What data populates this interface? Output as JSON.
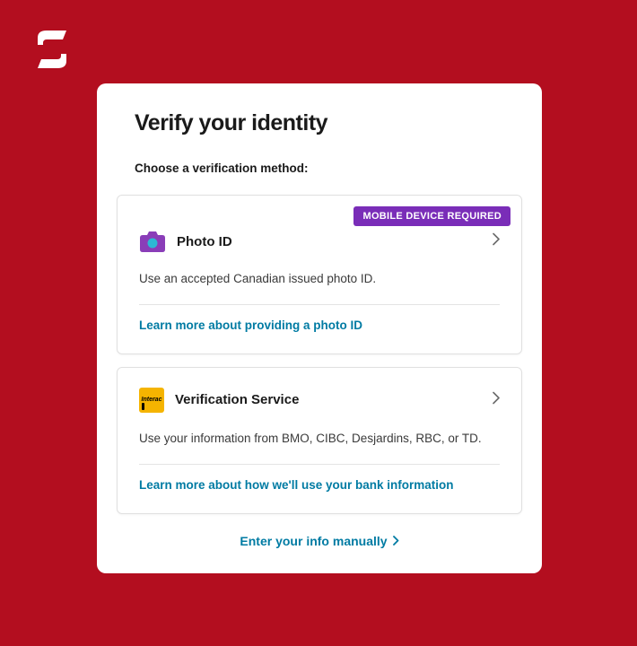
{
  "colors": {
    "brand_red": "#b30e1f",
    "badge_purple": "#7a2db8",
    "link_teal": "#007ba3"
  },
  "page": {
    "title": "Verify your identity",
    "subtitle": "Choose a verification method:"
  },
  "options": [
    {
      "badge": "MOBILE DEVICE REQUIRED",
      "icon": "camera-icon",
      "title": "Photo ID",
      "description": "Use an accepted Canadian issued photo ID.",
      "learn_more": "Learn more about providing a photo ID"
    },
    {
      "icon": "interac-icon",
      "title": "Verification Service",
      "description": "Use your information from BMO, CIBC, Desjardins, RBC, or TD.",
      "learn_more": "Learn more about how we'll use your bank information"
    }
  ],
  "manual_link": "Enter your info manually",
  "interac_label": "Interac"
}
